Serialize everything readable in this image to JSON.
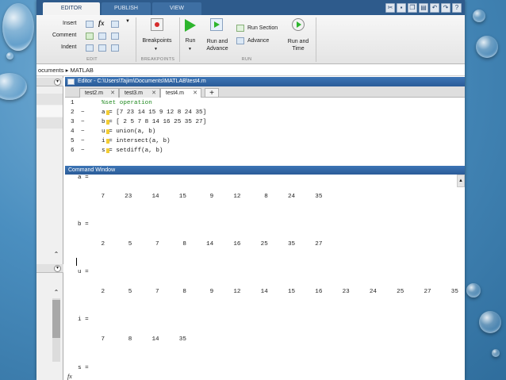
{
  "ribbon_tabs": [
    {
      "label": "EDITOR",
      "active": true
    },
    {
      "label": "PUBLISH",
      "active": false
    },
    {
      "label": "VIEW",
      "active": false
    }
  ],
  "ribbon": {
    "insert": "Insert",
    "fx": "fx",
    "comment": "Comment",
    "indent": "Indent",
    "edit_group": "EDIT",
    "breakpoints": "Breakpoints",
    "breakpoints_group": "BREAKPOINTS",
    "run": "Run",
    "run_and_advance": "Run and\nAdvance",
    "run_section": "Run Section",
    "advance": "Advance",
    "run_and_time": "Run and\nTime",
    "run_group": "RUN"
  },
  "address": "ocuments  ▸  MATLAB",
  "editor": {
    "title": "Editor - C:\\Users\\Tajim\\Documents\\MATLAB\\test4.m",
    "tabs": [
      {
        "label": "test2.m",
        "active": false
      },
      {
        "label": "test3.m",
        "active": false
      },
      {
        "label": "test4.m",
        "active": true
      }
    ],
    "plus": "+",
    "lines": [
      {
        "num": "1",
        "dash": "",
        "text": "%set operation",
        "comment": true
      },
      {
        "num": "2",
        "dash": "−",
        "text": "a = [7 23 14 15 9 12 8 24 35]",
        "comment": false
      },
      {
        "num": "3",
        "dash": "−",
        "text": "b = [ 2 5 7 8 14 16 25 35 27]",
        "comment": false
      },
      {
        "num": "4",
        "dash": "−",
        "text": "u = union(a, b)",
        "comment": false
      },
      {
        "num": "5",
        "dash": "−",
        "text": "i = intersect(a, b)",
        "comment": false
      },
      {
        "num": "6",
        "dash": "−",
        "text": "s = setdiff(a, b)",
        "comment": false
      }
    ]
  },
  "command_window": {
    "title": "Command Window",
    "outputs": [
      {
        "name": "a =",
        "values": [
          "7",
          "23",
          "14",
          "15",
          "9",
          "12",
          "8",
          "24",
          "35"
        ]
      },
      {
        "name": "b =",
        "values": [
          "2",
          "5",
          "7",
          "8",
          "14",
          "16",
          "25",
          "35",
          "27"
        ]
      },
      {
        "name": "u =",
        "values": [
          "2",
          "5",
          "7",
          "8",
          "9",
          "12",
          "14",
          "15",
          "16",
          "23",
          "24",
          "25",
          "27",
          "35"
        ]
      },
      {
        "name": "i =",
        "values": [
          "7",
          "8",
          "14",
          "35"
        ]
      },
      {
        "name": "s =",
        "values": []
      }
    ],
    "fx_label": "fx"
  },
  "icons": {
    "collapse": "chevron-down-icon",
    "qat": [
      "cut-icon",
      "save-icon",
      "copy-icon",
      "paste-icon",
      "undo-icon",
      "redo-icon",
      "help-icon"
    ]
  },
  "colors": {
    "titlebar": "#2e5b8c",
    "panel_title": "#3468a9",
    "comment": "#228b22",
    "highlight": "#f1c40f"
  }
}
